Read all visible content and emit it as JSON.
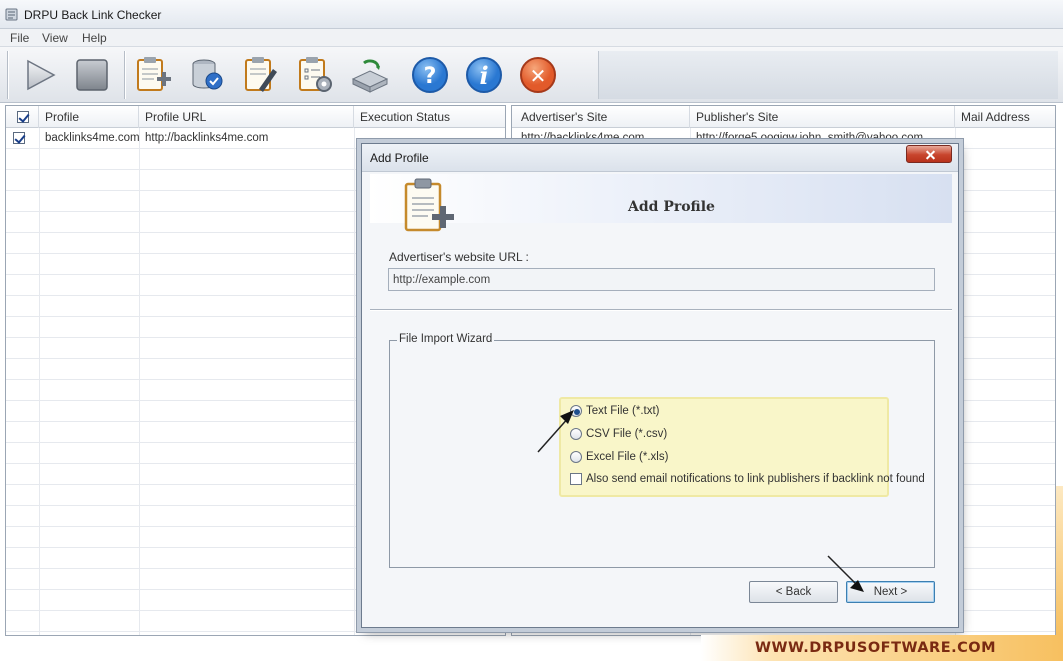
{
  "window": {
    "title": "DRPU Back Link Checker"
  },
  "menu": [
    "File",
    "View",
    "Help"
  ],
  "toolbar": {
    "buttons": [
      {
        "name": "play-icon"
      },
      {
        "name": "stop-icon"
      },
      {
        "name": "add-profile-icon"
      },
      {
        "name": "database-icon"
      },
      {
        "name": "edit-profile-icon"
      },
      {
        "name": "settings-list-icon"
      },
      {
        "name": "refresh-drive-icon"
      },
      {
        "name": "help-icon",
        "glyph": "?"
      },
      {
        "name": "info-icon",
        "glyph": "i"
      },
      {
        "name": "exit-icon",
        "glyph": "✕"
      }
    ]
  },
  "profile_table": {
    "columns": [
      "Profile",
      "Profile URL",
      "Execution Status"
    ],
    "rows": [
      {
        "checked": true,
        "profile": "backlinks4me.com",
        "url": "http://backlinks4me.com",
        "status": ""
      }
    ]
  },
  "link_table": {
    "columns": [
      "Advertiser's Site",
      "Publisher's Site",
      "Mail Address"
    ],
    "rows": [
      {
        "advertiser": "http://backlinks4me.com",
        "publisher": "http://forge5.oogiqw.john_smith@yahoo.com",
        "mail": ""
      }
    ]
  },
  "dialog": {
    "title": "Add Profile",
    "heading": "Add Profile",
    "url_label": "Advertiser's website URL :",
    "url_value": "http://example.com",
    "group_label": "File Import Wizard",
    "options": [
      {
        "label": "Text File (*.txt)",
        "selected": true
      },
      {
        "label": "CSV File (*.csv)",
        "selected": false
      },
      {
        "label": "Excel File (*.xls)",
        "selected": false
      }
    ],
    "notify_label": "Also send email notifications to link publishers if backlink not found",
    "notify_checked": false,
    "back_label": "< Back",
    "next_label": "Next >"
  },
  "watermark": "WWW.DRPUSOFTWARE.COM",
  "colors": {
    "highlight": "#f9f6c9",
    "close": "#c8452d",
    "help": "#2a78d2",
    "exit": "#e25a2a",
    "watermark": "#7a2a12"
  }
}
